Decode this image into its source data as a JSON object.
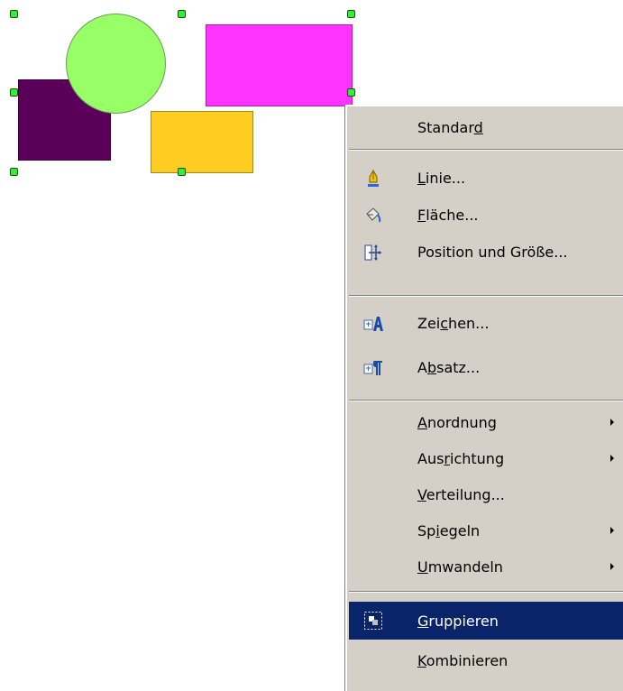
{
  "canvas": {
    "shapes": [
      {
        "name": "purple-rectangle",
        "fill": "#5a005a"
      },
      {
        "name": "green-circle",
        "fill": "#99ff66"
      },
      {
        "name": "magenta-rectangle",
        "fill": "#ff33ff"
      },
      {
        "name": "yellow-rectangle",
        "fill": "#ffcc22"
      }
    ],
    "handle_color": "#33ee33"
  },
  "context_menu": {
    "background": "#d4d0c8",
    "highlight": "#0a246a",
    "items": [
      {
        "label": "Standard",
        "mnemonic_index": 7,
        "icon": "",
        "submenu": false
      },
      {
        "label": "Linie...",
        "mnemonic_index": 0,
        "icon": "line-pen-icon",
        "submenu": false
      },
      {
        "label": "Fläche...",
        "mnemonic_index": 0,
        "icon": "area-fill-bucket-icon",
        "submenu": false
      },
      {
        "label": "Position und Größe...",
        "mnemonic_index": -1,
        "icon": "position-size-icon",
        "submenu": false
      },
      {
        "label": "Zeichen...",
        "mnemonic_index": 3,
        "icon": "character-icon",
        "submenu": false
      },
      {
        "label": "Absatz...",
        "mnemonic_index": 1,
        "icon": "paragraph-icon",
        "submenu": false
      },
      {
        "label": "Anordnung",
        "mnemonic_index": 0,
        "icon": "",
        "submenu": true
      },
      {
        "label": "Ausrichtung",
        "mnemonic_index": 3,
        "icon": "",
        "submenu": true
      },
      {
        "label": "Verteilung...",
        "mnemonic_index": 0,
        "icon": "",
        "submenu": false
      },
      {
        "label": "Spiegeln",
        "mnemonic_index": 2,
        "icon": "",
        "submenu": true
      },
      {
        "label": "Umwandeln",
        "mnemonic_index": 0,
        "icon": "",
        "submenu": true
      },
      {
        "label": "Gruppieren",
        "mnemonic_index": 0,
        "icon": "group-icon",
        "submenu": false,
        "highlighted": true
      },
      {
        "label": "Kombinieren",
        "mnemonic_index": 0,
        "icon": "",
        "submenu": false
      }
    ]
  }
}
